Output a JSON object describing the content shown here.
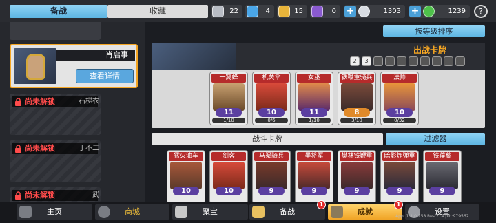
{
  "tabs": {
    "active": "备战",
    "inactive": "收藏"
  },
  "resources": [
    {
      "icon": "silver-shield-icon",
      "value": "22",
      "color": "#b8bcc4"
    },
    {
      "icon": "blue-shield-icon",
      "value": "4",
      "color": "#4aa6e8"
    },
    {
      "icon": "gold-shield-icon",
      "value": "15",
      "color": "#e8b43a"
    },
    {
      "icon": "purple-shield-icon",
      "value": "0",
      "color": "#8a5ad0"
    }
  ],
  "currency": [
    {
      "icon": "silver-coin-icon",
      "value": "1303",
      "color": "#d8dce2"
    },
    {
      "icon": "green-gem-icon",
      "value": "1239",
      "color": "#4ec04a"
    }
  ],
  "help_label": "?",
  "heroes": {
    "selected": {
      "name": "肖启事",
      "detail_label": "查看详情"
    },
    "locked": [
      {
        "status": "尚未解锁",
        "name": "石梯衣"
      },
      {
        "status": "尚未解锁",
        "name": "丁不二"
      },
      {
        "status": "尚未解锁",
        "name": "武"
      }
    ]
  },
  "sort_label": "按等级排序",
  "deck": {
    "title": "出战卡牌",
    "cards": [
      {
        "name": "一窝蜂",
        "level": "11",
        "progress": "1/10",
        "color": "#b62b2b",
        "art": "#c8a070"
      },
      {
        "name": "机关伞",
        "level": "10",
        "progress": "0/6",
        "color": "#b62b2b",
        "art": "#d84a3a"
      },
      {
        "name": "女巫",
        "level": "11",
        "progress": "1/10",
        "color": "#b62b2b",
        "art": "#e08a4a"
      },
      {
        "name": "铁鞭重骑兵",
        "level": "8",
        "progress": "3/10",
        "color": "#b62b2b",
        "art": "#7a4a3a"
      },
      {
        "name": "法师",
        "level": "10",
        "progress": "0/32",
        "color": "#b62b2b",
        "art": "#e8953a"
      }
    ]
  },
  "battle_cards_label": "战斗卡牌",
  "filter_label": "过滤器",
  "collection": {
    "cards": [
      {
        "name": "猛火油车",
        "level": "10",
        "color": "#b62b2b",
        "art": "#a8583a"
      },
      {
        "name": "剑客",
        "level": "10",
        "color": "#b62b2b",
        "art": "#d84a3a"
      },
      {
        "name": "马渠骑兵",
        "level": "9",
        "color": "#b62b2b",
        "art": "#7a3a2a"
      },
      {
        "name": "墨将军",
        "level": "9",
        "color": "#b62b2b",
        "art": "#c84a3a"
      },
      {
        "name": "樊林铁鞭重骑兵",
        "level": "9",
        "color": "#b62b2b",
        "art": "#8a3a3a"
      },
      {
        "name": "暗影炸弹重灵",
        "level": "9",
        "color": "#b62b2b",
        "art": "#7a4a3a"
      },
      {
        "name": "铁蒺藜",
        "level": "9",
        "color": "#b62b2b",
        "art": "#6a6a72"
      }
    ]
  },
  "nav": [
    {
      "label": "主页",
      "icon": "home-icon"
    },
    {
      "label": "商城",
      "icon": "shop-icon"
    },
    {
      "label": "聚宝",
      "icon": "treasure-icon"
    },
    {
      "label": "备战",
      "icon": "cards-icon",
      "badge": "1"
    },
    {
      "label": "成就",
      "icon": "achievement-icon",
      "badge": "1"
    },
    {
      "label": "设置",
      "icon": "gear-icon"
    }
  ],
  "version": "App: 1.1.0.158 Res:214 pid:979562"
}
